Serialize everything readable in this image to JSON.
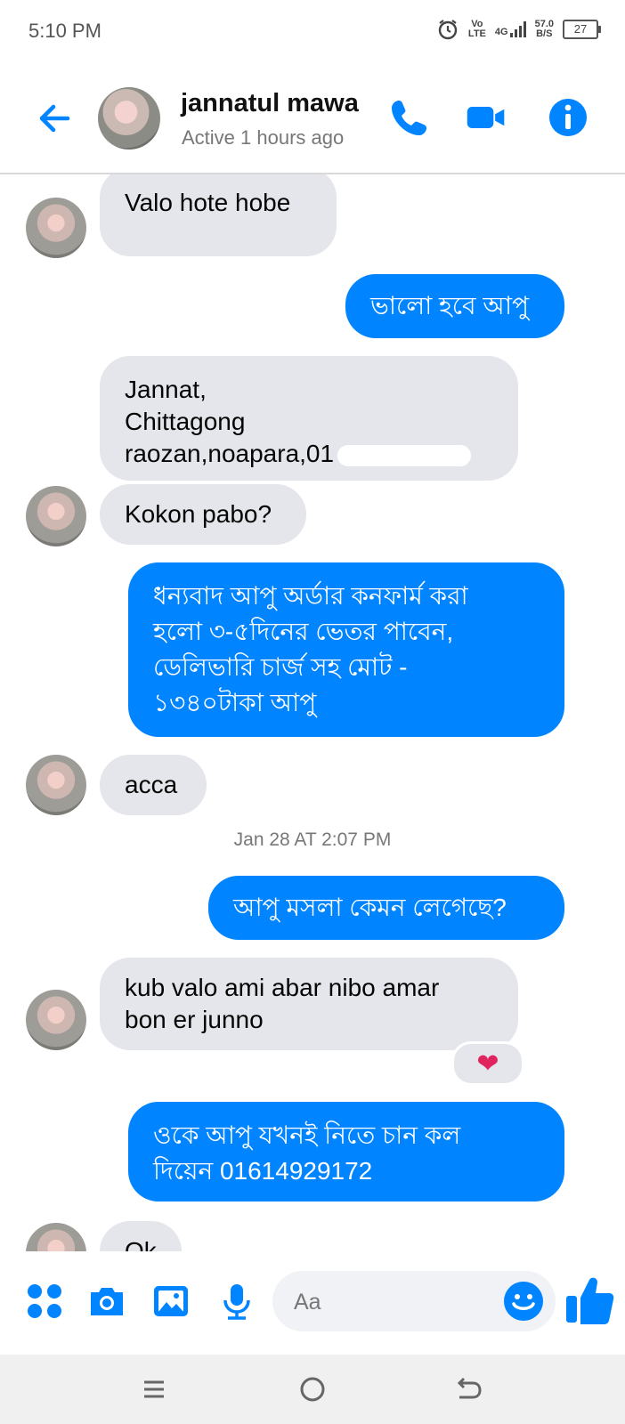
{
  "status_bar": {
    "time": "5:10 PM",
    "network_top": "Vo",
    "network_bottom": "LTE",
    "signal_type": "4G",
    "speed_value": "57.0",
    "speed_unit": "B/S",
    "battery": "27"
  },
  "header": {
    "contact_name": "jannatul mawa",
    "status": "Active 1 hours ago",
    "icons": [
      "back-arrow-icon",
      "phone-icon",
      "video-icon",
      "info-icon"
    ],
    "accent_color": "#0084ff"
  },
  "messages": [
    {
      "side": "incoming",
      "text": "Valo hote hobe"
    },
    {
      "side": "outgoing",
      "text": "ভালো হবে আপু"
    },
    {
      "side": "incoming",
      "lines": [
        "Jannat,",
        "Chittagong",
        "raozan,noapara,01"
      ]
    },
    {
      "side": "incoming",
      "text": "Kokon pabo?"
    },
    {
      "side": "outgoing",
      "lines": [
        "ধন্যবাদ আপু অর্ডার কনফার্ম করা",
        "হলো ৩-৫দিনের ভেতর পাবেন,",
        "ডেলিভারি চার্জ সহ মোট -",
        "১৩৪০টাকা আপু"
      ]
    },
    {
      "side": "incoming",
      "text": "acca"
    },
    {
      "type": "timestamp",
      "text": "Jan 28 AT 2:07 PM"
    },
    {
      "side": "outgoing",
      "text": "আপু মসলা কেমন লেগেছে?"
    },
    {
      "side": "incoming",
      "lines": [
        "kub valo ami abar nibo amar",
        "bon er junno"
      ],
      "reaction": "❤"
    },
    {
      "side": "outgoing",
      "lines": [
        "ওকে আপু যখনই নিতে চান কল",
        "দিয়েন 01614929172"
      ]
    },
    {
      "side": "incoming",
      "text": "Ok"
    }
  ],
  "composer": {
    "placeholder": "Aa",
    "icons": [
      "menu-dots-icon",
      "camera-icon",
      "gallery-icon",
      "microphone-icon",
      "emoji-icon",
      "thumbs-up-icon"
    ]
  },
  "nav_bar": {
    "icons": [
      "recent-apps-icon",
      "home-icon",
      "back-icon"
    ]
  }
}
